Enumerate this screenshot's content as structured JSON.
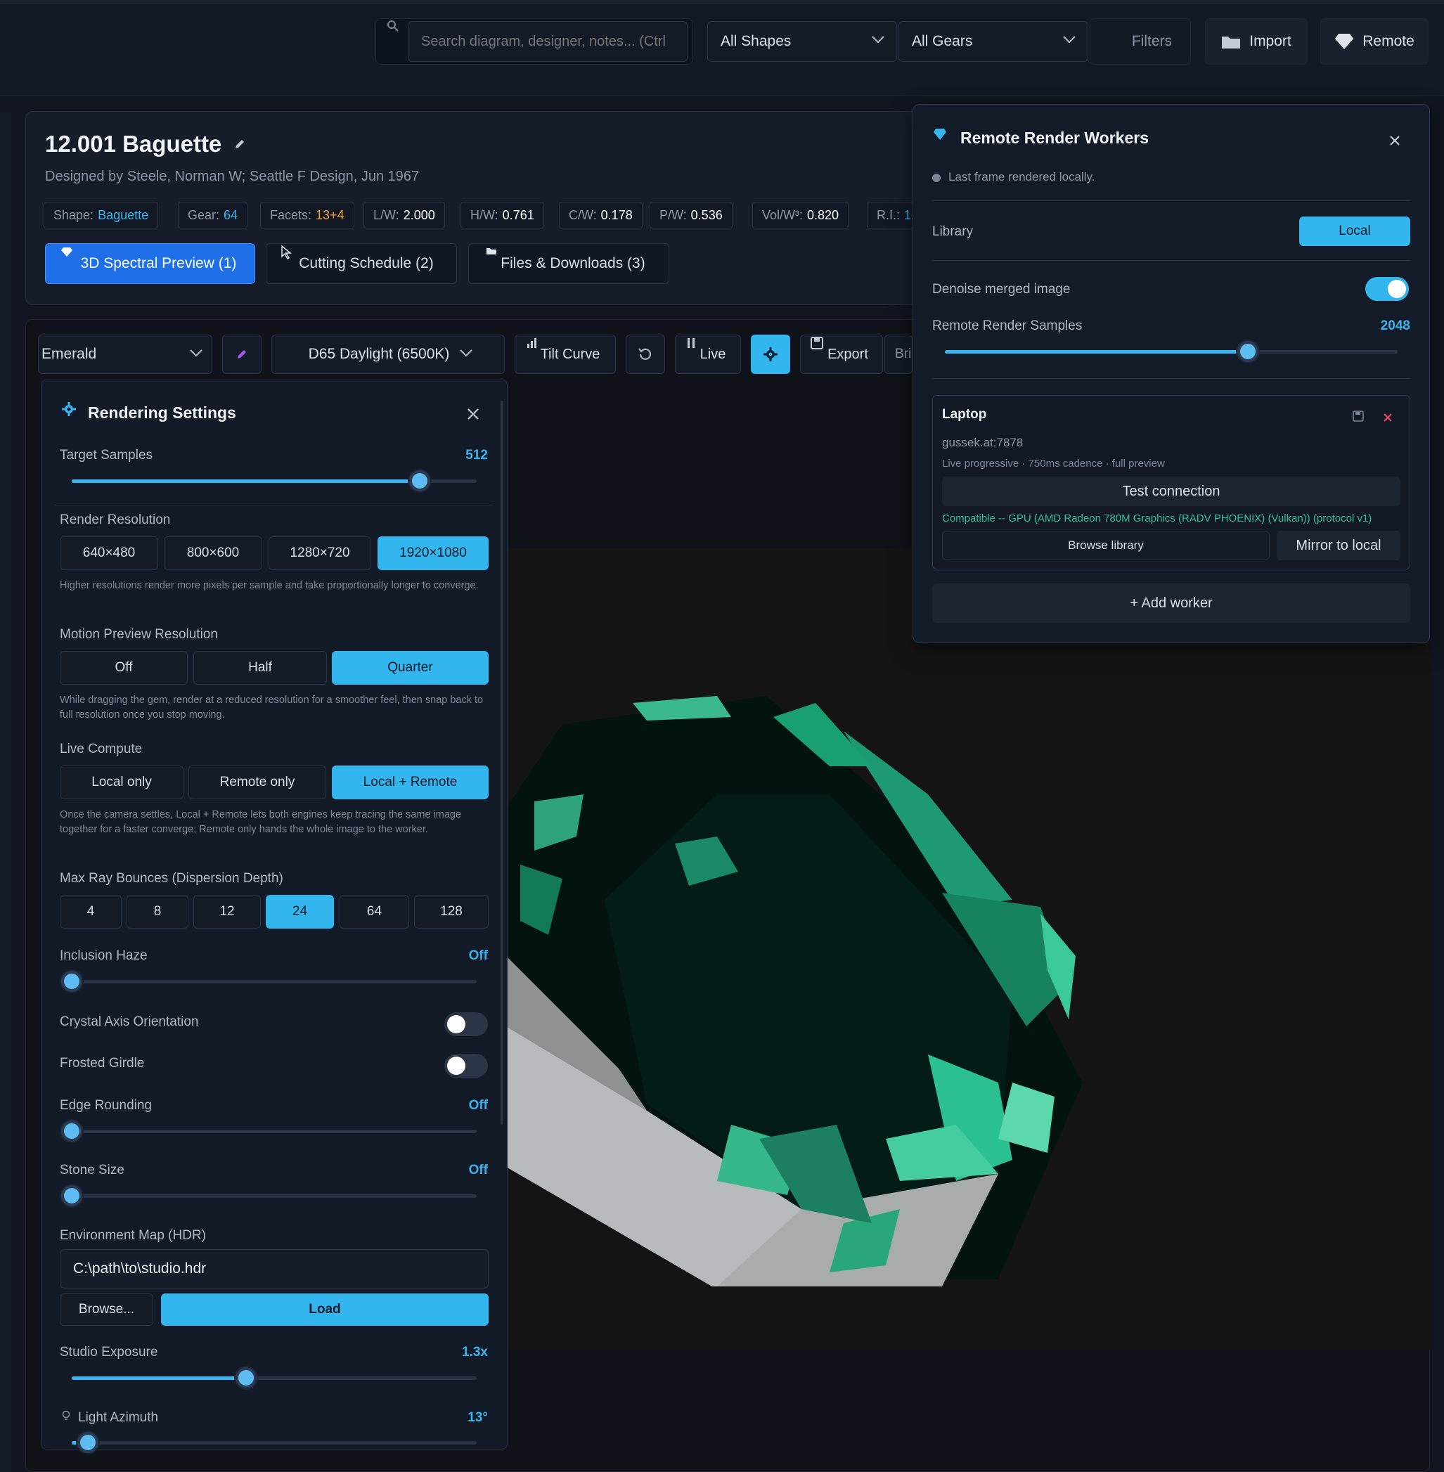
{
  "topbar": {
    "search_placeholder": "Search diagram, designer, notes... (Ctrl",
    "shapes_select": "All Shapes",
    "gears_select": "All Gears",
    "filters_label": "Filters",
    "import_label": "Import",
    "remote_label": "Remote"
  },
  "gem": {
    "title": "12.001 Baguette",
    "subtitle": "Designed by Steele, Norman W; Seattle F Design, Jun 1967",
    "chips": [
      {
        "key": "Shape:",
        "value": "Baguette"
      },
      {
        "key": "Gear:",
        "value": "64"
      },
      {
        "key": "Facets:",
        "value": "13+4"
      },
      {
        "key": "L/W:",
        "value": "2.000"
      },
      {
        "key": "H/W:",
        "value": "0.761"
      },
      {
        "key": "C/W:",
        "value": "0.178"
      },
      {
        "key": "P/W:",
        "value": "0.536"
      },
      {
        "key": "Vol/W³:",
        "value": "0.820"
      },
      {
        "key": "R.I.:",
        "value": "1."
      }
    ],
    "tabs": [
      "3D Spectral Preview (1)",
      "Cutting Schedule (2)",
      "Files & Downloads (3)"
    ]
  },
  "toolbar": {
    "material": "Emerald",
    "illuminant": "D65 Daylight (6500K)",
    "tilt_curve": "Tilt Curve",
    "live": "Live",
    "export": "Export",
    "bri": "Bri"
  },
  "render_settings": {
    "title": "Rendering Settings",
    "target_samples_label": "Target Samples",
    "target_samples_value": "512",
    "target_samples_fraction": 0.86,
    "render_resolution_label": "Render Resolution",
    "resolutions": [
      "640×480",
      "800×600",
      "1280×720",
      "1920×1080"
    ],
    "resolution_selected": 3,
    "resolution_hint": "Higher resolutions render more pixels per sample and take proportionally longer to converge.",
    "motion_label": "Motion Preview Resolution",
    "motion_options": [
      "Off",
      "Half",
      "Quarter"
    ],
    "motion_selected": 2,
    "motion_hint": "While dragging the gem, render at a reduced resolution for a smoother feel, then snap back to full resolution once you stop moving.",
    "compute_label": "Live Compute",
    "compute_options": [
      "Local only",
      "Remote only",
      "Local + Remote"
    ],
    "compute_selected": 2,
    "compute_hint": "Once the camera settles, Local + Remote lets both engines keep tracing the same image together for a faster converge; Remote only hands the whole image to the worker.",
    "bounces_label": "Max Ray Bounces (Dispersion Depth)",
    "bounces": [
      "4",
      "8",
      "12",
      "24",
      "64",
      "128"
    ],
    "bounces_selected": 3,
    "haze_label": "Inclusion Haze",
    "haze_value": "Off",
    "crystal_label": "Crystal Axis Orientation",
    "crystal_on": false,
    "frosted_label": "Frosted Girdle",
    "frosted_on": false,
    "edge_label": "Edge Rounding",
    "edge_value": "Off",
    "stone_label": "Stone Size",
    "stone_value": "Off",
    "env_label": "Environment Map (HDR)",
    "env_path": "C:\\path\\to\\studio.hdr",
    "browse": "Browse...",
    "load": "Load",
    "exposure_label": "Studio Exposure",
    "exposure_value": "1.3x",
    "exposure_fraction": 0.43,
    "azimuth_label": "Light Azimuth",
    "azimuth_value": "13°",
    "azimuth_fraction": 0.04
  },
  "remote": {
    "title": "Remote Render Workers",
    "status": "Last frame rendered locally.",
    "library_label": "Library",
    "library_button": "Local",
    "denoise_label": "Denoise merged image",
    "denoise_on": true,
    "samples_label": "Remote Render Samples",
    "samples_value": "2048",
    "samples_fraction": 0.67,
    "worker": {
      "name": "Laptop",
      "host": "gussek.at:7878",
      "mode": "Live progressive · 750ms cadence · full preview",
      "test": "Test connection",
      "compat": "Compatible -- GPU (AMD Radeon 780M Graphics (RADV PHOENIX) (Vulkan)) (protocol v1)",
      "browse": "Browse library",
      "mirror": "Mirror to local"
    },
    "add_worker": "+ Add worker"
  },
  "colors": {
    "accent": "#33b6ee",
    "tab_active": "#1f6fe8",
    "gem_green": "#1fa77a",
    "chip_orange": "#f0a030"
  }
}
